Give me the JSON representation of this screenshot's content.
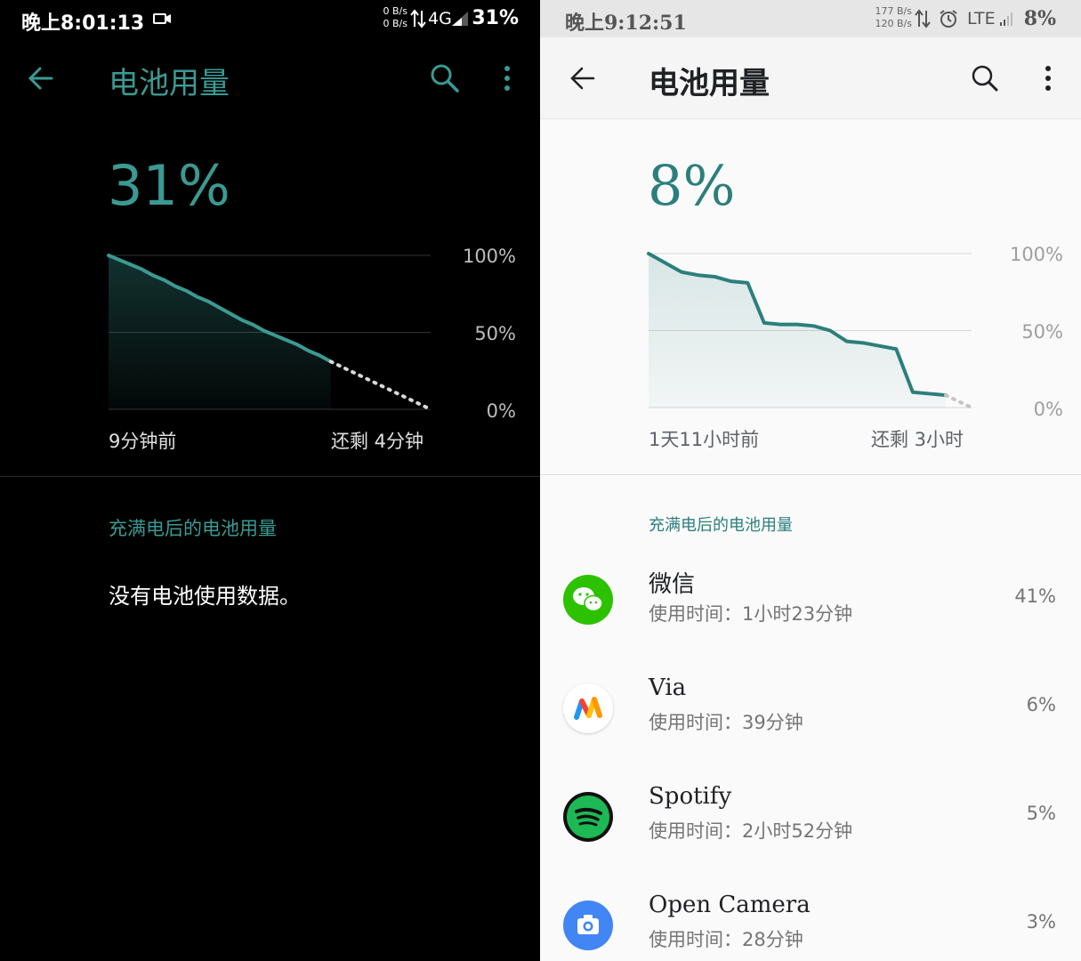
{
  "left": {
    "status": {
      "time": "晚上8:01:13",
      "rate_up": "0 B/s",
      "rate_down": "0 B/s",
      "network": "4G",
      "battery": "31%"
    },
    "toolbar": {
      "title": "电池用量"
    },
    "battery_percent": "31%",
    "chart_data": {
      "type": "line",
      "y_ticks": [
        "100%",
        "50%",
        "0%"
      ],
      "ylim": [
        0,
        100
      ],
      "x_start_label": "9分钟前",
      "x_end_label": "还剩 4分钟",
      "series": [
        {
          "values": [
            100,
            97,
            94,
            91,
            87,
            84,
            80,
            77,
            73,
            70,
            66,
            62,
            58,
            55,
            51,
            48,
            45,
            42,
            38,
            35,
            31
          ]
        }
      ],
      "projection": [
        31,
        0
      ]
    },
    "section_header": "充满电后的电池用量",
    "empty_message": "没有电池使用数据。"
  },
  "right": {
    "status": {
      "time": "晚上9:12:51",
      "rate_up": "177 B/s",
      "rate_down": "120 B/s",
      "network": "LTE",
      "battery": "8%"
    },
    "toolbar": {
      "title": "电池用量"
    },
    "battery_percent": "8%",
    "chart_data": {
      "type": "line",
      "y_ticks": [
        "100%",
        "50%",
        "0%"
      ],
      "ylim": [
        0,
        100
      ],
      "x_start_label": "1天11小时前",
      "x_end_label": "还剩 3小时",
      "series": [
        {
          "values": [
            100,
            94,
            88,
            86,
            85,
            82,
            81,
            55,
            54,
            54,
            53,
            50,
            43,
            42,
            40,
            38,
            10,
            9,
            8
          ]
        }
      ],
      "projection": [
        8,
        0
      ]
    },
    "section_header": "充满电后的电池用量",
    "apps": [
      {
        "name": "微信",
        "usage": "使用时间：1小时23分钟",
        "percent": "41%",
        "icon": "wechat-icon",
        "color": "#2dc100"
      },
      {
        "name": "Via",
        "usage": "使用时间：39分钟",
        "percent": "6%",
        "icon": "via-icon",
        "color": "#ffffff"
      },
      {
        "name": "Spotify",
        "usage": "使用时间：2小时52分钟",
        "percent": "5%",
        "icon": "spotify-icon",
        "color": "#1db954"
      },
      {
        "name": "Open Camera",
        "usage": "使用时间：28分钟",
        "percent": "3%",
        "icon": "camera-icon",
        "color": "#4285f4"
      }
    ]
  },
  "colors": {
    "accent_dark": "#3a9a93",
    "accent_light": "#2b7f7c"
  }
}
